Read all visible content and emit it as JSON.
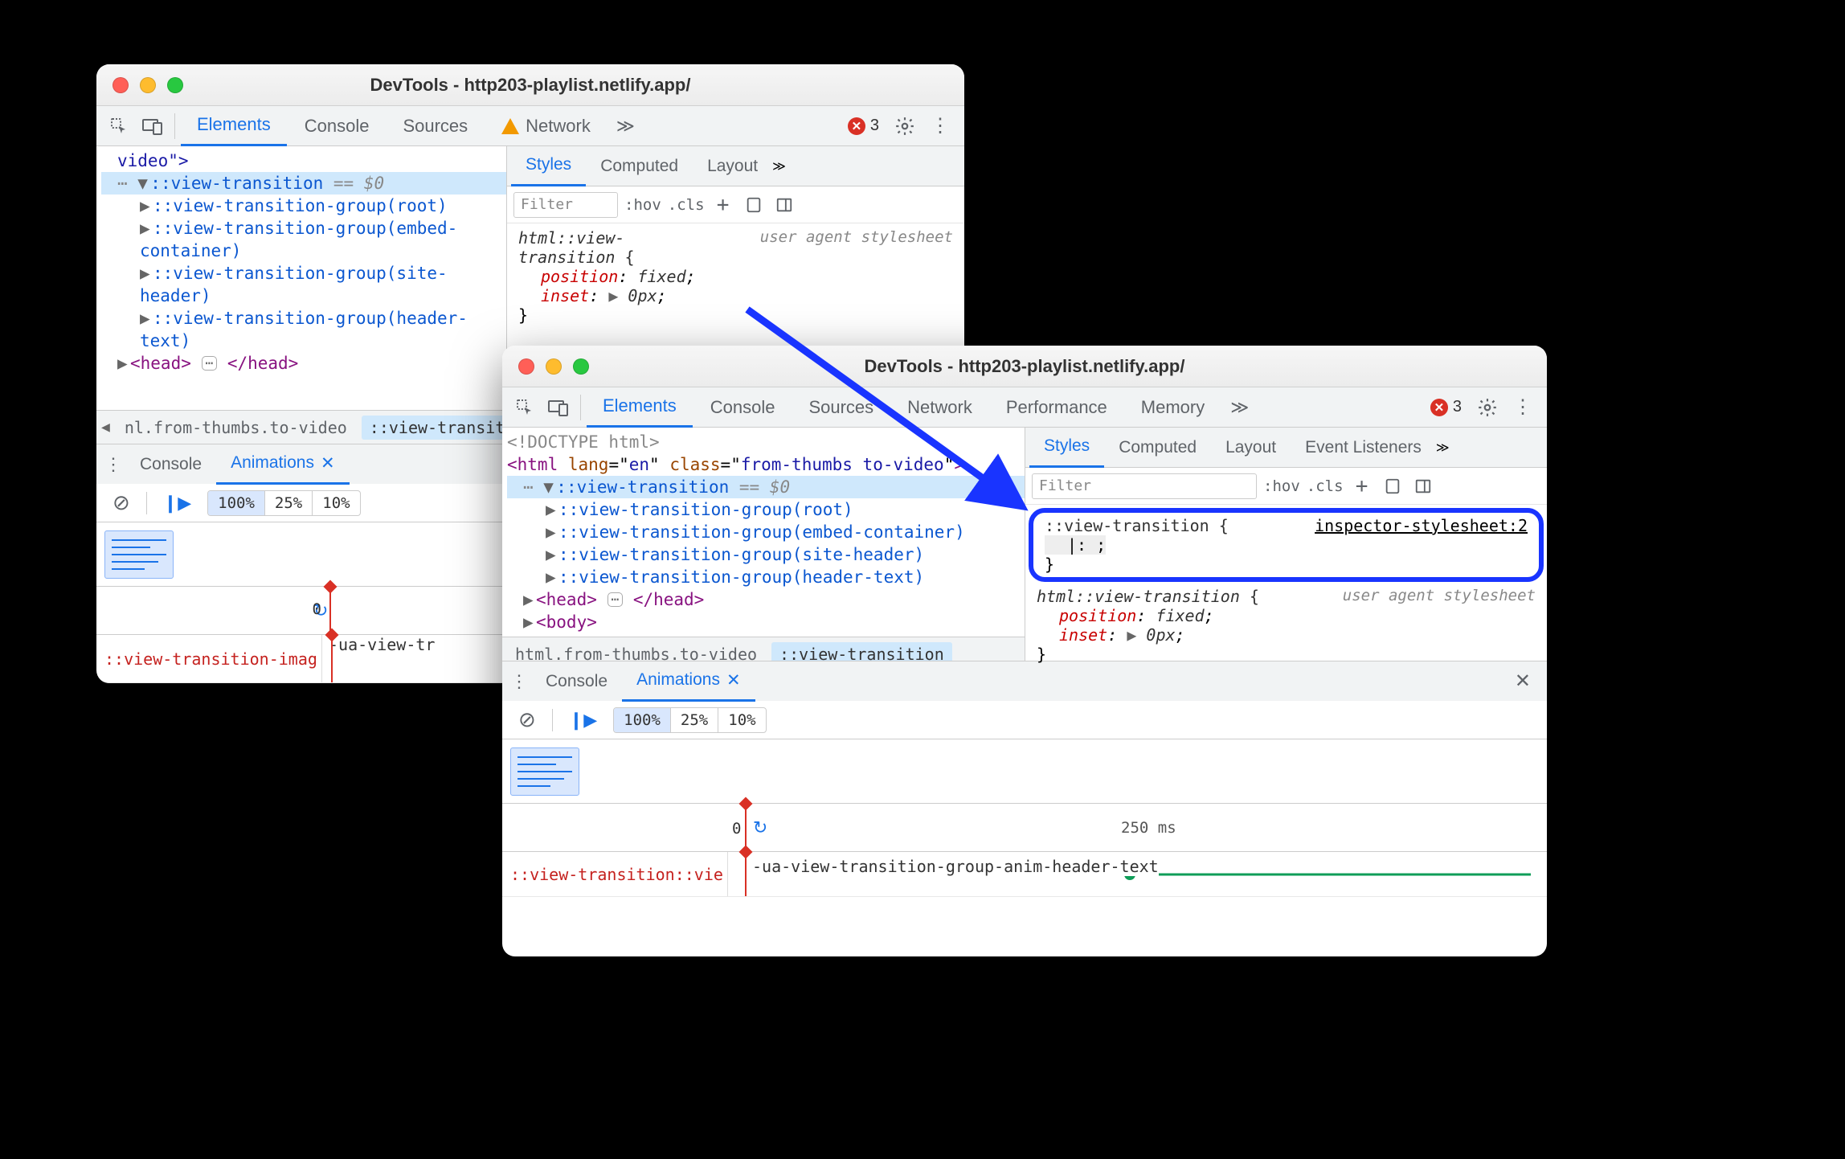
{
  "window_title": "DevTools - http203-playlist.netlify.app/",
  "error_count": "3",
  "tabs_small": [
    "Elements",
    "Console",
    "Sources",
    "Network"
  ],
  "tabs_large": [
    "Elements",
    "Console",
    "Sources",
    "Network",
    "Performance",
    "Memory"
  ],
  "styles_tabs_small": [
    "Styles",
    "Computed",
    "Layout"
  ],
  "styles_tabs_large": [
    "Styles",
    "Computed",
    "Layout",
    "Event Listeners"
  ],
  "filter_placeholder": "Filter",
  "hov": ":hov",
  "cls": ".cls",
  "dom_small": {
    "video_close": "video\">",
    "vt": "::view-transition",
    "eq0": "== $0",
    "g_root": "::view-transition-group(root)",
    "g_embed1": "::view-transition-group(embed-",
    "g_embed2": "container)",
    "g_site1": "::view-transition-group(site-",
    "g_site2": "header)",
    "g_header1": "::view-transition-group(header-",
    "g_header2": "text)",
    "head_open": "<head>",
    "head_close": "</head>"
  },
  "dom_large": {
    "doctype": "<!DOCTYPE html>",
    "html_open": "<html lang=\"en\" class=\"from-thumbs to-video\">",
    "vt": "::view-transition",
    "eq0": "== $0",
    "g_root": "::view-transition-group(root)",
    "g_embed": "::view-transition-group(embed-container)",
    "g_site": "::view-transition-group(site-header)",
    "g_header": "::view-transition-group(header-text)",
    "head_open": "<head>",
    "head_close": "</head>",
    "body_open": "<body>"
  },
  "breadcrumb_small": {
    "item1": "nl.from-thumbs.to-video",
    "item2": "::view-transition"
  },
  "breadcrumb_large": {
    "item1": "html.from-thumbs.to-video",
    "item2": "::view-transition"
  },
  "styles_ua": {
    "selector": "html::view-transition {",
    "source": "user agent stylesheet",
    "prop1": "position",
    "val1": "fixed",
    "prop2": "inset",
    "val2": "0px",
    "close": "}"
  },
  "styles_inspector": {
    "selector": "::view-transition {",
    "source": "inspector-stylesheet:2",
    "empty_decl": "|:  ;",
    "close": "}"
  },
  "drawer": {
    "console": "Console",
    "animations": "Animations"
  },
  "speeds": [
    "100%",
    "25%",
    "10%"
  ],
  "time_zero": "0",
  "time_250": "250 ms",
  "anim_label_small": "::view-transition-imag",
  "anim_name_small": "-ua-view-tr",
  "anim_label_large": "::view-transition::vie",
  "anim_name_large": "-ua-view-transition-group-anim-header-text"
}
